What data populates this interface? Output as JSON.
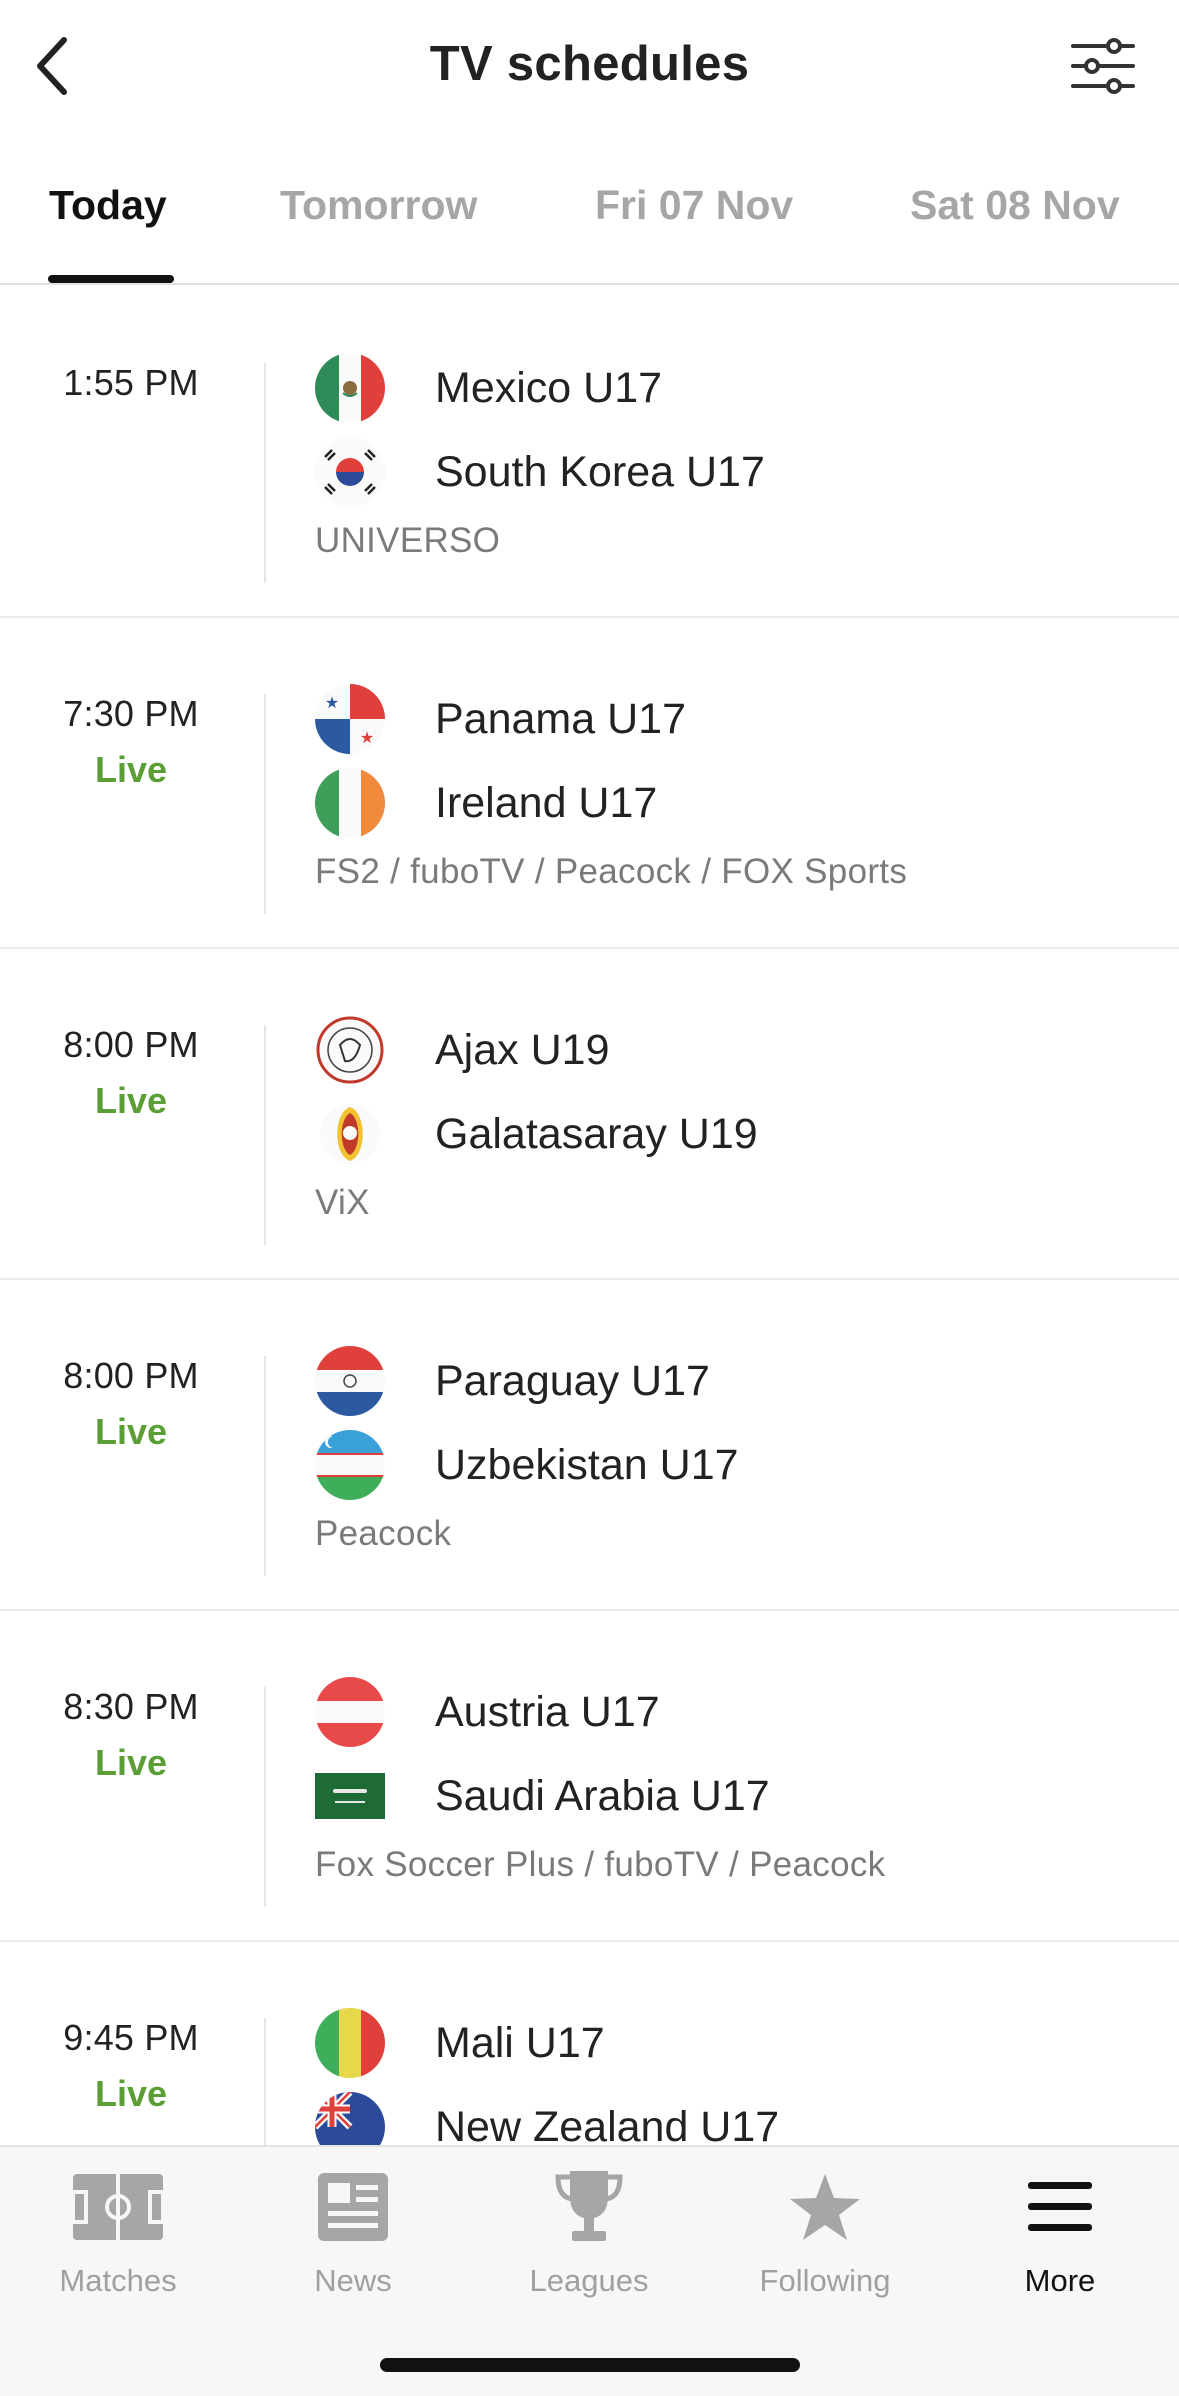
{
  "header": {
    "title": "TV schedules",
    "back_icon": "chevron-left-icon",
    "filter_icon": "sliders-icon"
  },
  "tabs": [
    {
      "label": "Today",
      "active": true
    },
    {
      "label": "Tomorrow",
      "active": false
    },
    {
      "label": "Fri 07 Nov",
      "active": false
    },
    {
      "label": "Sat 08 Nov",
      "active": false
    }
  ],
  "colors": {
    "live": "#5a9e35",
    "active_text": "#111111",
    "inactive_text": "#a6a6a6"
  },
  "matches": [
    {
      "time": "1:55 PM",
      "live": "",
      "home": {
        "name": "Mexico U17",
        "flag": "mexico-flag-icon"
      },
      "away": {
        "name": "South Korea U17",
        "flag": "south-korea-flag-icon"
      },
      "channels": "UNIVERSO"
    },
    {
      "time": "7:30 PM",
      "live": "Live",
      "home": {
        "name": "Panama U17",
        "flag": "panama-flag-icon"
      },
      "away": {
        "name": "Ireland U17",
        "flag": "ireland-flag-icon"
      },
      "channels": "FS2 / fuboTV / Peacock / FOX Sports"
    },
    {
      "time": "8:00 PM",
      "live": "Live",
      "home": {
        "name": "Ajax U19",
        "flag": "ajax-crest-icon"
      },
      "away": {
        "name": "Galatasaray U19",
        "flag": "galatasaray-crest-icon"
      },
      "channels": "ViX"
    },
    {
      "time": "8:00 PM",
      "live": "Live",
      "home": {
        "name": "Paraguay U17",
        "flag": "paraguay-flag-icon"
      },
      "away": {
        "name": "Uzbekistan U17",
        "flag": "uzbekistan-flag-icon"
      },
      "channels": "Peacock"
    },
    {
      "time": "8:30 PM",
      "live": "Live",
      "home": {
        "name": "Austria U17",
        "flag": "austria-flag-icon"
      },
      "away": {
        "name": "Saudi Arabia U17",
        "flag": "saudi-arabia-flag-icon"
      },
      "channels": "Fox Soccer Plus / fuboTV / Peacock"
    },
    {
      "time": "9:45 PM",
      "live": "Live",
      "home": {
        "name": "Mali U17",
        "flag": "mali-flag-icon"
      },
      "away": {
        "name": "New Zealand U17",
        "flag": "new-zealand-flag-icon"
      },
      "channels": ""
    }
  ],
  "bottom_nav": [
    {
      "label": "Matches",
      "icon": "pitch-icon",
      "active": false
    },
    {
      "label": "News",
      "icon": "newspaper-icon",
      "active": false
    },
    {
      "label": "Leagues",
      "icon": "trophy-icon",
      "active": false
    },
    {
      "label": "Following",
      "icon": "star-icon",
      "active": false
    },
    {
      "label": "More",
      "icon": "menu-icon",
      "active": true
    }
  ]
}
